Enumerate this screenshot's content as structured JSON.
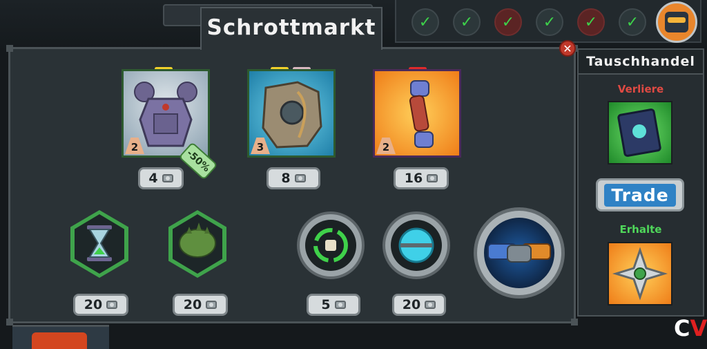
{
  "title": "Schrottmarkt",
  "completed_checks": [
    {
      "icon": "check-icon",
      "color": "#3dd14a"
    },
    {
      "icon": "check-icon",
      "color": "#3dd14a"
    },
    {
      "icon": "check-icon",
      "color": "#3dd14a",
      "accent": "red"
    },
    {
      "icon": "check-icon",
      "color": "#3dd14a"
    },
    {
      "icon": "check-icon",
      "color": "#3dd14a",
      "accent": "red"
    },
    {
      "icon": "check-icon",
      "color": "#3dd14a"
    }
  ],
  "shop": {
    "cards": [
      {
        "name": "purple-armor-bot",
        "level": "2",
        "price": "4",
        "discount": "-50%",
        "rarity_color": "#f2d12a"
      },
      {
        "name": "scrap-golem",
        "level": "3",
        "price": "8",
        "rarity_color": "#f2d12a"
      },
      {
        "name": "spiked-arm",
        "level": "2",
        "price": "16",
        "rarity_color": "#e02a2a"
      }
    ],
    "items": [
      {
        "name": "hourglass",
        "price": "20",
        "icon": "hourglass-icon"
      },
      {
        "name": "spiked-helmet",
        "price": "20",
        "icon": "spiked-helmet-icon"
      },
      {
        "name": "recycle-dice",
        "price": "5",
        "icon": "recycle-dice-icon"
      },
      {
        "name": "energy-orb",
        "price": "20",
        "icon": "energy-orb-icon"
      }
    ],
    "handshake_icon": "handshake-icon"
  },
  "trade": {
    "title": "Tauschhandel",
    "lose_label": "Verliere",
    "get_label": "Erhalte",
    "button_label": "Trade",
    "lose_item": "tech-book-card",
    "get_item": "shuriken-card"
  },
  "close_icon": "close-icon",
  "logo": {
    "left": "C",
    "right": "V"
  },
  "colors": {
    "accent_green": "#3fa34b",
    "lose_red": "#e04a43",
    "get_green": "#4fd65a",
    "trade_blue": "#2f82c5"
  }
}
